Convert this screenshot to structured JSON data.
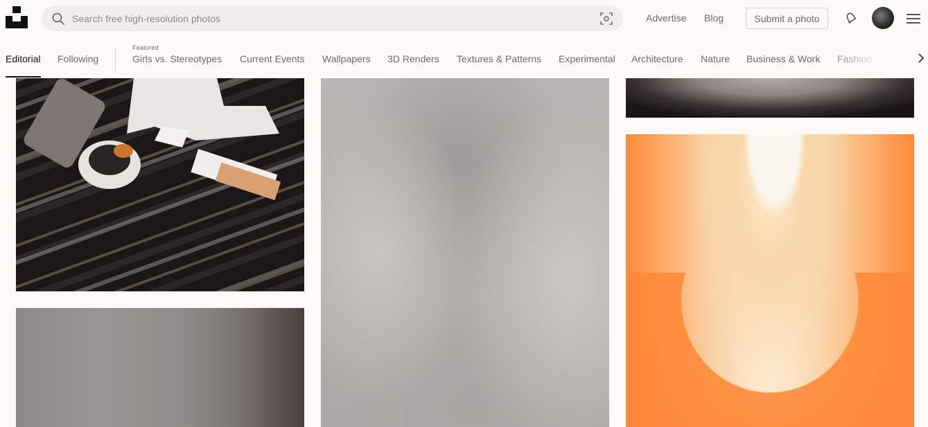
{
  "header": {
    "search": {
      "placeholder": "Search free high-resolution photos",
      "value": ""
    },
    "nav": {
      "advertise": "Advertise",
      "blog": "Blog"
    },
    "submit_label": "Submit a photo"
  },
  "tabs": {
    "items": [
      {
        "label": "Editorial",
        "active": true
      },
      {
        "label": "Following"
      },
      {
        "label": "Girls vs. Stereotypes",
        "featured": true
      },
      {
        "label": "Current Events"
      },
      {
        "label": "Wallpapers"
      },
      {
        "label": "3D Renders"
      },
      {
        "label": "Textures & Patterns"
      },
      {
        "label": "Experimental"
      },
      {
        "label": "Architecture"
      },
      {
        "label": "Nature"
      },
      {
        "label": "Business & Work"
      },
      {
        "label": "Fashion"
      }
    ],
    "featured_caption": "Featured"
  },
  "colors": {
    "background": "#fbfaf6",
    "text": "#111111",
    "muted": "#6b6b6b",
    "border": "#d1d1d1",
    "accent_orange": "#fd8a3a"
  },
  "icons": [
    "unsplash-logo",
    "search-icon",
    "visual-search-icon",
    "bell-icon",
    "avatar",
    "hamburger-menu-icon",
    "chevron-right-icon"
  ]
}
